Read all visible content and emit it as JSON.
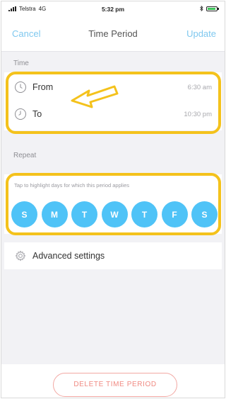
{
  "status_bar": {
    "carrier": "Telstra",
    "network": "4G",
    "time": "5:32 pm"
  },
  "nav": {
    "cancel_label": "Cancel",
    "title": "Time Period",
    "update_label": "Update"
  },
  "time_section": {
    "label": "Time",
    "rows": [
      {
        "icon": "clock-icon",
        "label": "From",
        "value": "6:30 am"
      },
      {
        "icon": "clock-icon",
        "label": "To",
        "value": "10:30 pm"
      }
    ]
  },
  "repeat_section": {
    "label": "Repeat",
    "hint": "Tap to highlight days for which this period applies",
    "days": [
      "S",
      "M",
      "T",
      "W",
      "T",
      "F",
      "S"
    ]
  },
  "advanced": {
    "icon": "gear-icon",
    "label": "Advanced settings"
  },
  "delete_label": "DELETE TIME PERIOD",
  "colors": {
    "accent": "#7fc8ef",
    "day_circle": "#4fc3f7",
    "highlight": "#f4c21c",
    "delete": "#f08a82"
  }
}
